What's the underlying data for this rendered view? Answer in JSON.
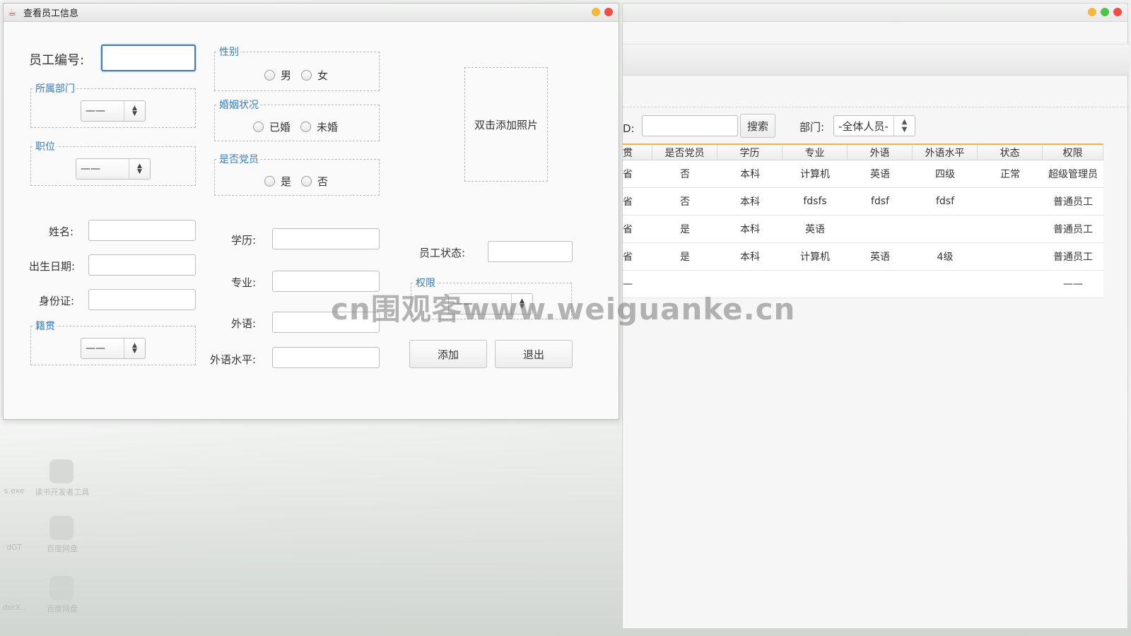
{
  "front_window": {
    "title": "查看员工信息",
    "employee_id_label": "员工编号:",
    "employee_id_value": "",
    "dept_group_title": "所属部门",
    "dept_select_value": "——",
    "position_group_title": "职位",
    "position_select_value": "——",
    "gender_group_title": "性别",
    "gender_options": [
      "男",
      "女"
    ],
    "marital_group_title": "婚姻状况",
    "marital_options": [
      "已婚",
      "未婚"
    ],
    "party_group_title": "是否党员",
    "party_options": [
      "是",
      "否"
    ],
    "photo_label": "双击添加照片",
    "name_label": "姓名:",
    "birth_label": "出生日期:",
    "id_card_label": "身份证:",
    "native_group_title": "籍贯",
    "native_select_value": "——",
    "education_label": "学历:",
    "major_label": "专业:",
    "language_label": "外语:",
    "language_level_label": "外语水平:",
    "status_label": "员工状态:",
    "permission_group_title": "权限",
    "permission_select_value": "——",
    "add_button": "添加",
    "exit_button": "退出"
  },
  "back_window": {
    "search_label": "D:",
    "search_button": "搜索",
    "dept_label": "部门:",
    "dept_select_value": "-全体人员-",
    "table": {
      "headers": [
        "贯",
        "是否党员",
        "学历",
        "专业",
        "外语",
        "外语水平",
        "状态",
        "权限"
      ],
      "rows": [
        [
          "省",
          "否",
          "本科",
          "计算机",
          "英语",
          "四级",
          "正常",
          "超级管理员"
        ],
        [
          "省",
          "否",
          "本科",
          "fdsfs",
          "fdsf",
          "fdsf",
          "",
          "普通员工"
        ],
        [
          "省",
          "是",
          "本科",
          "英语",
          "",
          "",
          "",
          "普通员工"
        ],
        [
          "省",
          "是",
          "本科",
          "计算机",
          "英语",
          "4级",
          "",
          "普通员工"
        ],
        [
          "—",
          "",
          "",
          "",
          "",
          "",
          "",
          "——"
        ]
      ]
    }
  },
  "watermark": "cn围观客www.weiguanke.cn",
  "desktop": {
    "icon_labels": [
      "s.exe",
      "读书开发者工具",
      "dGT",
      "百度网盘",
      "derX..",
      "百度网盘"
    ]
  },
  "colors": {
    "accent_blue": "#3a7bb0",
    "table_header_accent": "#f5b14a",
    "close_red": "#ef4d45",
    "minimize_yellow": "#f4b93c",
    "maximize_green": "#4fc44a"
  }
}
